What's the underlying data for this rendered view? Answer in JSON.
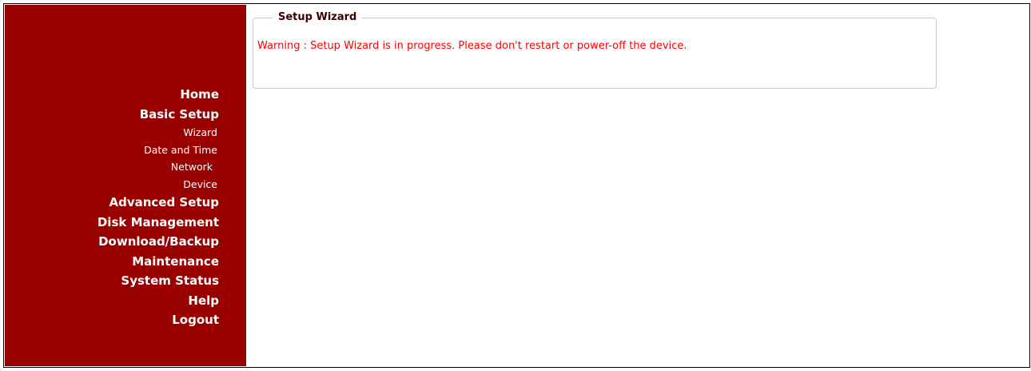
{
  "sidebar": {
    "background_color": "#990000",
    "items": [
      {
        "label": "Home",
        "level": "main"
      },
      {
        "label": "Basic Setup",
        "level": "main"
      },
      {
        "label": "Wizard",
        "level": "sub"
      },
      {
        "label": "Date and Time",
        "level": "sub"
      },
      {
        "label": "Network",
        "level": "sub"
      },
      {
        "label": "Device",
        "level": "sub"
      },
      {
        "label": "Advanced Setup",
        "level": "main"
      },
      {
        "label": "Disk Management",
        "level": "main"
      },
      {
        "label": "Download/Backup",
        "level": "main"
      },
      {
        "label": "Maintenance",
        "level": "main"
      },
      {
        "label": "System Status",
        "level": "main"
      },
      {
        "label": "Help",
        "level": "main"
      },
      {
        "label": "Logout",
        "level": "main"
      }
    ]
  },
  "main": {
    "section_title": "Setup Wizard",
    "warning_text": "Warning : Setup Wizard is in progress. Please don't restart or power-off the device.",
    "warning_color": "#ff0000"
  }
}
